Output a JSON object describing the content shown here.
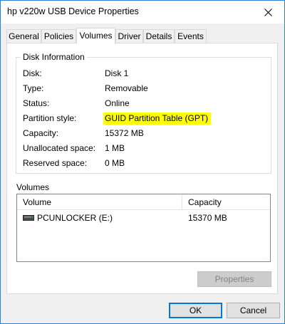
{
  "window": {
    "title": "hp v220w USB Device Properties"
  },
  "tabs": [
    {
      "label": "General"
    },
    {
      "label": "Policies"
    },
    {
      "label": "Volumes"
    },
    {
      "label": "Driver"
    },
    {
      "label": "Details"
    },
    {
      "label": "Events"
    }
  ],
  "active_tab": "Volumes",
  "disk_info": {
    "group_label": "Disk Information",
    "rows": [
      {
        "label": "Disk:",
        "value": "Disk 1"
      },
      {
        "label": "Type:",
        "value": "Removable"
      },
      {
        "label": "Status:",
        "value": "Online"
      },
      {
        "label": "Partition style:",
        "value": "GUID Partition Table (GPT)"
      },
      {
        "label": "Capacity:",
        "value": "15372 MB"
      },
      {
        "label": "Unallocated space:",
        "value": "1 MB"
      },
      {
        "label": "Reserved space:",
        "value": "0 MB"
      }
    ],
    "highlight_color": "#ffff00"
  },
  "volumes": {
    "label": "Volumes",
    "columns": [
      "Volume",
      "Capacity"
    ],
    "rows": [
      {
        "volume": "PCUNLOCKER (E:)",
        "capacity": "15370 MB",
        "icon": "drive-icon"
      }
    ],
    "properties_button": "Properties"
  },
  "footer": {
    "ok": "OK",
    "cancel": "Cancel"
  },
  "colors": {
    "accent": "#0078d7",
    "window_border": "#2b7fd4"
  }
}
